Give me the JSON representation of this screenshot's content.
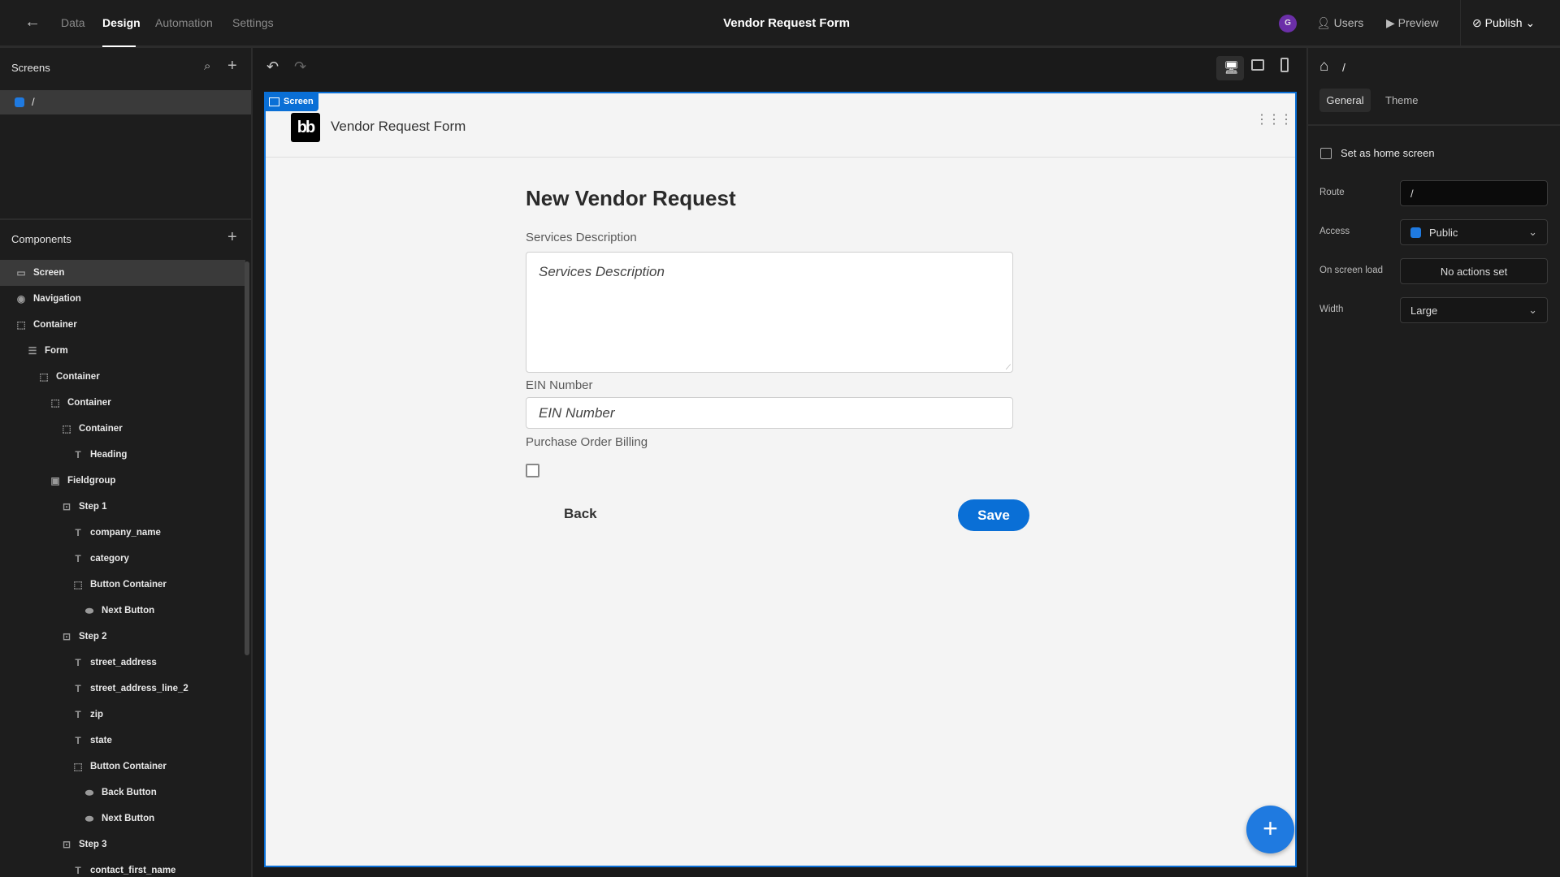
{
  "topbar": {
    "tabs": [
      "Data",
      "Design",
      "Automation",
      "Settings"
    ],
    "active_tab": "Design",
    "title": "Vendor Request Form",
    "avatar_initial": "G",
    "users": "Users",
    "preview": "Preview",
    "publish": "Publish"
  },
  "screens": {
    "title": "Screens",
    "items": [
      {
        "route": "/"
      }
    ]
  },
  "components": {
    "title": "Components",
    "tree": [
      {
        "label": "Screen",
        "depth": 0,
        "icon": "screen-icon",
        "selected": true
      },
      {
        "label": "Navigation",
        "depth": 0,
        "icon": "eye-icon"
      },
      {
        "label": "Container",
        "depth": 0,
        "icon": "container-icon"
      },
      {
        "label": "Form",
        "depth": 1,
        "icon": "form-icon"
      },
      {
        "label": "Container",
        "depth": 2,
        "icon": "container-icon"
      },
      {
        "label": "Container",
        "depth": 3,
        "icon": "container-icon"
      },
      {
        "label": "Container",
        "depth": 4,
        "icon": "container-icon"
      },
      {
        "label": "Heading",
        "depth": 5,
        "icon": "heading-icon"
      },
      {
        "label": "Fieldgroup",
        "depth": 3,
        "icon": "fieldgroup-icon"
      },
      {
        "label": "Step 1",
        "depth": 4,
        "icon": "step-icon"
      },
      {
        "label": "company_name",
        "depth": 5,
        "icon": "text-field-icon"
      },
      {
        "label": "category",
        "depth": 5,
        "icon": "text-field-icon"
      },
      {
        "label": "Button Container",
        "depth": 5,
        "icon": "container-icon"
      },
      {
        "label": "Next Button",
        "depth": 6,
        "icon": "button-icon"
      },
      {
        "label": "Step 2",
        "depth": 4,
        "icon": "step-icon"
      },
      {
        "label": "street_address",
        "depth": 5,
        "icon": "text-field-icon"
      },
      {
        "label": "street_address_line_2",
        "depth": 5,
        "icon": "text-field-icon"
      },
      {
        "label": "zip",
        "depth": 5,
        "icon": "text-field-icon"
      },
      {
        "label": "state",
        "depth": 5,
        "icon": "text-field-icon"
      },
      {
        "label": "Button Container",
        "depth": 5,
        "icon": "container-icon"
      },
      {
        "label": "Back Button",
        "depth": 6,
        "icon": "button-icon"
      },
      {
        "label": "Next Button",
        "depth": 6,
        "icon": "button-icon"
      },
      {
        "label": "Step 3",
        "depth": 4,
        "icon": "step-icon"
      },
      {
        "label": "contact_first_name",
        "depth": 5,
        "icon": "text-field-icon"
      }
    ]
  },
  "canvas": {
    "screen_badge": "Screen",
    "app_logo": "bb",
    "app_title": "Vendor Request Form",
    "form": {
      "heading": "New Vendor Request",
      "services_label": "Services Description",
      "services_placeholder": "Services Description",
      "ein_label": "EIN Number",
      "ein_placeholder": "EIN Number",
      "pob_label": "Purchase Order Billing",
      "pob_checked": false,
      "back": "Back",
      "save": "Save"
    }
  },
  "settings": {
    "breadcrumb": "/",
    "tabs": [
      "General",
      "Theme"
    ],
    "active_tab": "General",
    "home_screen_label": "Set as home screen",
    "home_screen_checked": false,
    "route_label": "Route",
    "route_value": "/",
    "access_label": "Access",
    "access_value": "Public",
    "onload_label": "On screen load",
    "onload_value": "No actions set",
    "width_label": "Width",
    "width_value": "Large"
  },
  "colors": {
    "accent": "#0a6fd6",
    "avatar": "#6b2fa8",
    "public": "#1f7ae0"
  }
}
